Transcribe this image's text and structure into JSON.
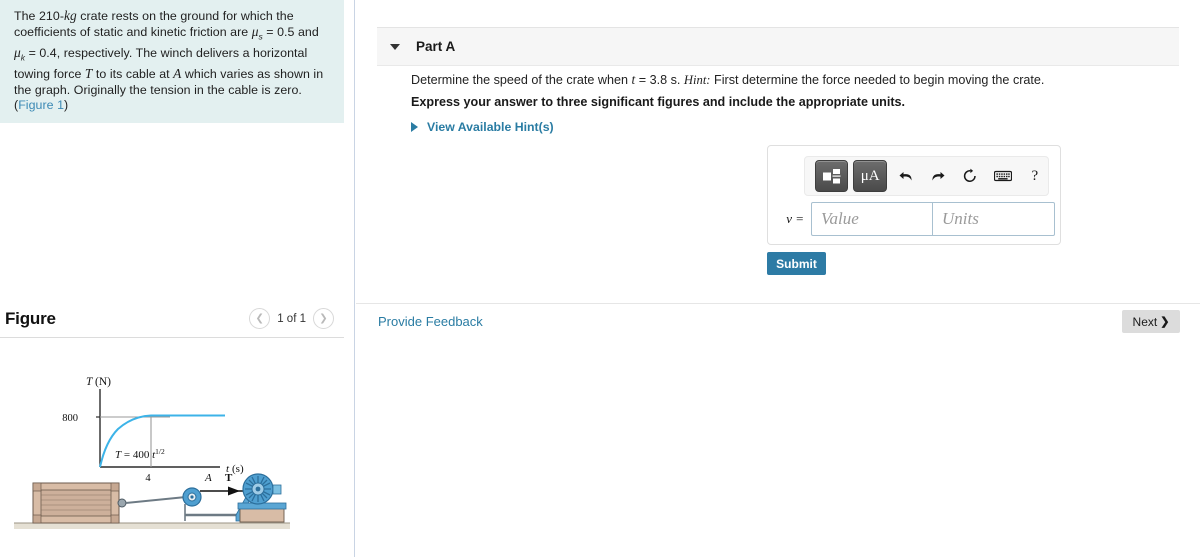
{
  "problem": {
    "text_parts": {
      "p1": "The 210-",
      "kg": "kg",
      "p2": " crate rests on the ground for which the coefficients of static and kinetic friction are ",
      "mu_s": "μ",
      "mu_s_sub": "s",
      "p3": " = 0.5 and ",
      "mu_k": "μ",
      "mu_k_sub": "k",
      "p4": " = 0.4, respectively. The winch delivers a horizontal towing force ",
      "T": "T",
      "p5": " to its cable at ",
      "A": "A",
      "p6": " which varies as shown in the graph. Originally the tension in the cable is zero. (",
      "figure_link": "Figure 1",
      "p7": ")"
    },
    "bg_color": "#e3f0f0",
    "link_color": "#3c8ab5"
  },
  "figure_panel": {
    "title": "Figure",
    "prev_icon": "chevron-left-icon",
    "next_icon": "chevron-right-icon",
    "counter": "1 of 1"
  },
  "chart_data": {
    "type": "line",
    "title": "",
    "xlabel": "t (s)",
    "ylabel": "T (N)",
    "equation_label": "T = 400 t",
    "equation_exponent": "1/2",
    "x_ticks": [
      "4"
    ],
    "y_ticks": [
      "800"
    ],
    "xlim": [
      0,
      8
    ],
    "ylim": [
      0,
      950
    ],
    "grid": false,
    "curve_color": "#3cb3e8",
    "guide_color": "#9a9a9a",
    "series": [
      {
        "name": "T(t)",
        "x": [
          0,
          0.25,
          0.5,
          0.75,
          1,
          1.5,
          2,
          2.5,
          3,
          3.5,
          4,
          5,
          6,
          7,
          8
        ],
        "y": [
          0,
          200,
          283,
          346,
          400,
          490,
          566,
          632,
          693,
          748,
          800,
          800,
          800,
          800,
          800
        ]
      }
    ],
    "annotations": [
      {
        "text": "T = 400 t^1/2",
        "x": 1.9,
        "y": 260
      },
      {
        "text": "800",
        "axis": "y",
        "value": 800
      },
      {
        "text": "4",
        "axis": "x",
        "value": 4
      }
    ]
  },
  "diagram": {
    "label_A": "A",
    "label_T": "T",
    "crate_color": "#d7b9a4",
    "winch_color": "#4f9fd0",
    "ground_color": "#ddd8cc"
  },
  "part": {
    "caret_icon": "caret-down-icon",
    "title": "Part A",
    "question_pre": "Determine the speed of the crate when ",
    "question_var": "t",
    "question_eq": " = 3.8 s. ",
    "hint_word": "Hint:",
    "question_post": " First determine the force needed to begin moving the crate.",
    "express": "Express your answer to three significant figures and include the appropriate units.",
    "hints_label": "View Available Hint(s)",
    "hints_icon": "triangle-right-icon"
  },
  "answer": {
    "toolbar": {
      "template_icon": "math-template-icon",
      "units_icon": "micro-angstrom-icon",
      "units_text": "μA",
      "undo_icon": "undo-arrow-icon",
      "redo_icon": "redo-arrow-icon",
      "reset_icon": "reset-circular-arrow-icon",
      "keyboard_icon": "keyboard-icon",
      "help_icon": "question-mark-icon",
      "help_text": "?"
    },
    "variable_label": "v =",
    "value_placeholder": "Value",
    "units_placeholder": "Units",
    "submit_label": "Submit",
    "submit_color": "#2d7ba5"
  },
  "footer": {
    "feedback_label": "Provide Feedback",
    "next_label": "Next",
    "next_chevron": "❯"
  }
}
